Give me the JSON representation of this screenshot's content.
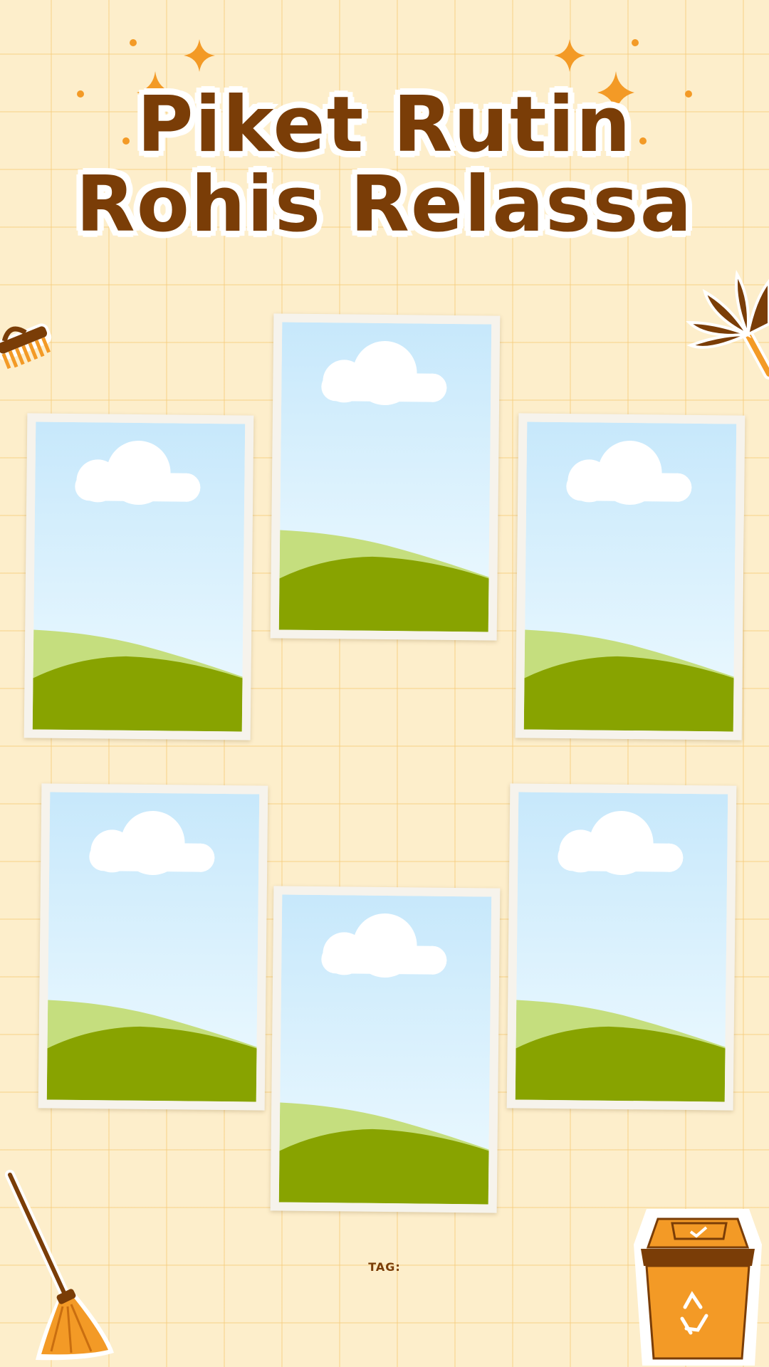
{
  "title": {
    "line1": "Piket Rutin",
    "line2": "Rohis Relassa"
  },
  "tag_label": "TAG:",
  "photos": [
    {
      "slot": "photo-frame-1"
    },
    {
      "slot": "photo-frame-2"
    },
    {
      "slot": "photo-frame-3"
    },
    {
      "slot": "photo-frame-4"
    },
    {
      "slot": "photo-frame-5"
    },
    {
      "slot": "photo-frame-6"
    }
  ],
  "icons": [
    "sparkle-icon",
    "brush-icon",
    "feather-duster-icon",
    "broom-icon",
    "trash-bin-icon",
    "recycle-icon"
  ],
  "colors": {
    "background": "#fdeecb",
    "title": "#7a3d07",
    "accent": "#f39a26",
    "sky_top": "#c7e8fb",
    "sky_bottom": "#eefaff",
    "hill_light": "#c5de7e",
    "hill_dark": "#88a300"
  }
}
